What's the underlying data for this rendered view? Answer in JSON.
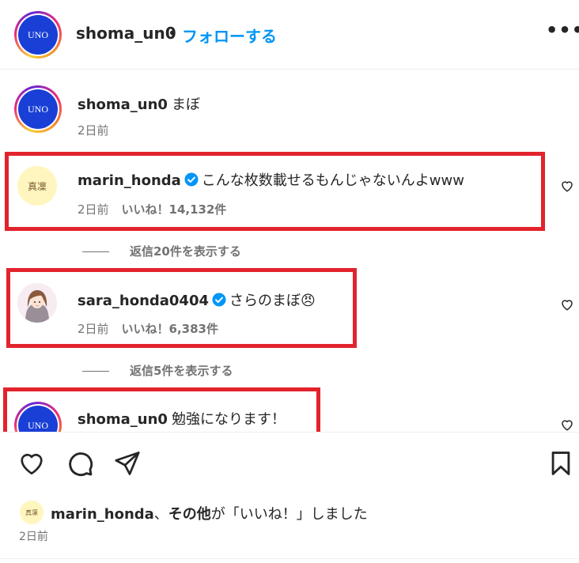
{
  "header": {
    "avatar_text": "UNO",
    "username": "shoma_un0",
    "dot": "•",
    "follow_label": "フォローする",
    "more_label": "•••"
  },
  "caption": {
    "avatar_text": "UNO",
    "username": "shoma_un0",
    "text": "まぼ",
    "time": "2日前"
  },
  "comments": [
    {
      "avatar_text": "真凜",
      "username": "marin_honda",
      "verified": true,
      "text": "こんな枚数載せるもんじゃないんよwww",
      "time": "2日前",
      "likes": "いいね！14,132件",
      "replies_label": "返信20件を表示する"
    },
    {
      "username": "sara_honda0404",
      "verified": true,
      "text": "さらのまぼ😠",
      "time": "2日前",
      "likes": "いいね！6,383件",
      "replies_label": "返信5件を表示する"
    },
    {
      "avatar_text": "UNO",
      "username": "shoma_un0",
      "text": "勉強になります！"
    }
  ],
  "footer": {
    "liked_avatar_text": "真凜",
    "liked_by_user": "marin_honda",
    "liked_sep": "、",
    "liked_others": "その他",
    "liked_suffix": "が「いいね！」しました",
    "time": "2日前"
  },
  "colors": {
    "accent": "#0095f6",
    "highlight_border": "#e3232c",
    "verified": "#0095f6",
    "uno_avatar": "#1a3fd6"
  },
  "icons": [
    "more-options-icon",
    "verified-badge-icon",
    "heart-icon",
    "comment-icon",
    "share-icon",
    "bookmark-icon"
  ]
}
